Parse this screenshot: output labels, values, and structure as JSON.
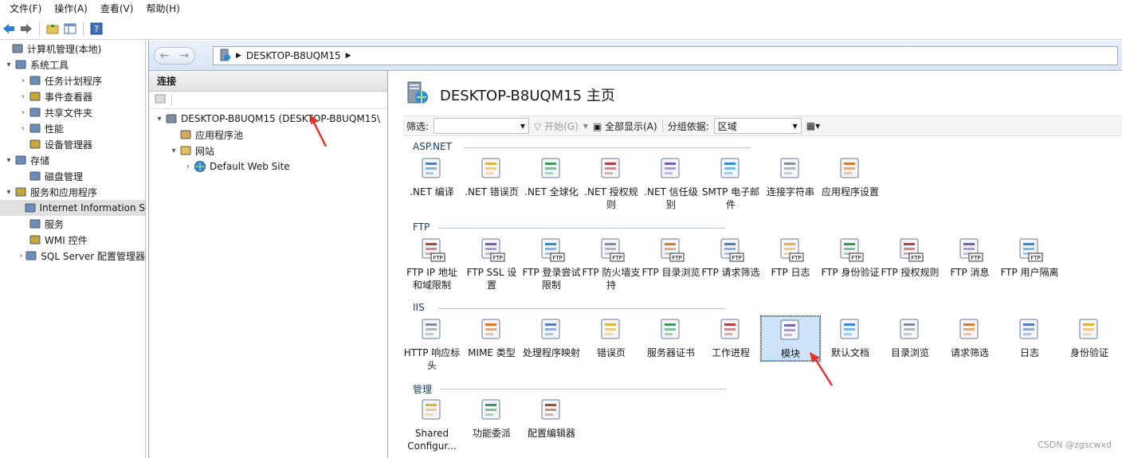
{
  "menubar": {
    "items": [
      "文件(F)",
      "操作(A)",
      "查看(V)",
      "帮助(H)"
    ]
  },
  "left_tree": {
    "items": [
      {
        "label": "计算机管理(本地)",
        "indent": 0,
        "expander": ""
      },
      {
        "label": "系统工具",
        "indent": 1,
        "expander": "▾"
      },
      {
        "label": "任务计划程序",
        "indent": 2,
        "expander": "›"
      },
      {
        "label": "事件查看器",
        "indent": 2,
        "expander": "›"
      },
      {
        "label": "共享文件夹",
        "indent": 2,
        "expander": "›"
      },
      {
        "label": "性能",
        "indent": 2,
        "expander": "›"
      },
      {
        "label": "设备管理器",
        "indent": 2,
        "expander": ""
      },
      {
        "label": "存储",
        "indent": 1,
        "expander": "▾"
      },
      {
        "label": "磁盘管理",
        "indent": 2,
        "expander": ""
      },
      {
        "label": "服务和应用程序",
        "indent": 1,
        "expander": "▾"
      },
      {
        "label": "Internet Information S",
        "indent": 2,
        "expander": "",
        "selected": true
      },
      {
        "label": "服务",
        "indent": 2,
        "expander": ""
      },
      {
        "label": "WMI 控件",
        "indent": 2,
        "expander": ""
      },
      {
        "label": "SQL Server 配置管理器",
        "indent": 2,
        "expander": "›"
      }
    ]
  },
  "addressbar": {
    "crumb": "DESKTOP-B8UQM15"
  },
  "connections": {
    "header": "连接",
    "tree": [
      {
        "label": "DESKTOP-B8UQM15 (DESKTOP-B8UQM15\\",
        "indent": 0,
        "expander": "▾"
      },
      {
        "label": "应用程序池",
        "indent": 1,
        "expander": ""
      },
      {
        "label": "网站",
        "indent": 1,
        "expander": "▾"
      },
      {
        "label": "Default Web Site",
        "indent": 2,
        "expander": "›"
      }
    ]
  },
  "home": {
    "title": "DESKTOP-B8UQM15 主页",
    "filter_label": "筛选:",
    "start_label": "开始(G)",
    "show_all_label": "全部显示(A)",
    "group_label": "分组依据:",
    "group_value": "区域"
  },
  "sections": [
    {
      "name": "ASP.NET",
      "tiles": [
        ".NET 编译",
        ".NET 错误页",
        ".NET 全球化",
        ".NET 授权规则",
        ".NET 信任级别",
        "SMTP 电子邮件",
        "连接字符串",
        "应用程序设置"
      ]
    },
    {
      "name": "FTP",
      "tiles": [
        "FTP IP 地址和域限制",
        "FTP SSL 设置",
        "FTP 登录尝试限制",
        "FTP 防火墙支持",
        "FTP 目录浏览",
        "FTP 请求筛选",
        "FTP 日志",
        "FTP 身份验证",
        "FTP 授权规则",
        "FTP 消息",
        "FTP 用户隔离"
      ]
    },
    {
      "name": "IIS",
      "tiles": [
        "HTTP 响应标头",
        "MIME 类型",
        "处理程序映射",
        "错误页",
        "服务器证书",
        "工作进程",
        "模块",
        "默认文档",
        "目录浏览",
        "请求筛选",
        "日志",
        "身份验证"
      ]
    },
    {
      "name": "管理",
      "tiles": [
        "Shared Configur...",
        "功能委派",
        "配置编辑器"
      ]
    }
  ],
  "watermark": "CSDN @zgscwxd",
  "colors": {
    "accent": "#1a3e6b",
    "selection": "#cde3f7",
    "arrow": "#e8332a"
  }
}
